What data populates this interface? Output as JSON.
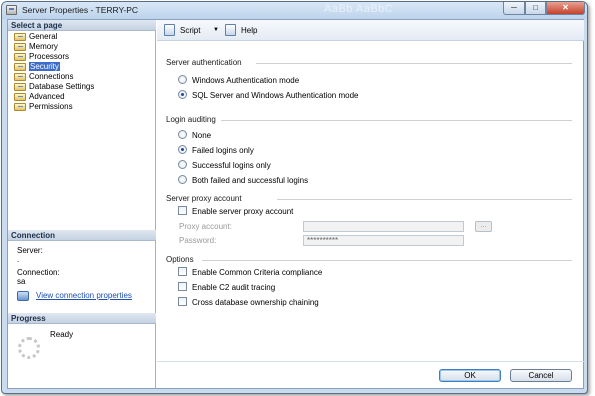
{
  "window": {
    "title": "Server Properties - TERRY-PC",
    "background_text": "AaBb AaBbC",
    "controls": {
      "minimize": "─",
      "maximize": "□",
      "close": "✕"
    }
  },
  "left": {
    "select_page_header": "Select a page",
    "pages": [
      {
        "label": "General",
        "selected": false
      },
      {
        "label": "Memory",
        "selected": false
      },
      {
        "label": "Processors",
        "selected": false
      },
      {
        "label": "Security",
        "selected": true
      },
      {
        "label": "Connections",
        "selected": false
      },
      {
        "label": "Database Settings",
        "selected": false
      },
      {
        "label": "Advanced",
        "selected": false
      },
      {
        "label": "Permissions",
        "selected": false
      }
    ],
    "connection": {
      "header": "Connection",
      "server_label": "Server:",
      "server_value": ".",
      "connection_label": "Connection:",
      "connection_value": "sa",
      "view_link": "View connection properties"
    },
    "progress": {
      "header": "Progress",
      "status": "Ready"
    }
  },
  "toolbar": {
    "script_label": "Script",
    "script_dropdown": "▼",
    "help_label": "Help"
  },
  "security": {
    "server_auth": {
      "heading": "Server authentication",
      "options": [
        {
          "label": "Windows Authentication mode",
          "checked": false
        },
        {
          "label": "SQL Server and Windows Authentication mode",
          "checked": true
        }
      ]
    },
    "login_auditing": {
      "heading": "Login auditing",
      "options": [
        {
          "label": "None",
          "checked": false
        },
        {
          "label": "Failed logins only",
          "checked": true
        },
        {
          "label": "Successful logins only",
          "checked": false
        },
        {
          "label": "Both failed and successful logins",
          "checked": false
        }
      ]
    },
    "proxy": {
      "heading": "Server proxy account",
      "enable_label": "Enable server proxy account",
      "proxy_account_label": "Proxy account:",
      "proxy_account_value": "",
      "browse_label": "...",
      "password_label": "Password:",
      "password_value": "**********"
    },
    "options": {
      "heading": "Options",
      "items": [
        {
          "label": "Enable Common Criteria compliance",
          "checked": false
        },
        {
          "label": "Enable C2 audit tracing",
          "checked": false
        },
        {
          "label": "Cross database ownership chaining",
          "checked": false
        }
      ]
    }
  },
  "buttons": {
    "ok": "OK",
    "cancel": "Cancel"
  }
}
